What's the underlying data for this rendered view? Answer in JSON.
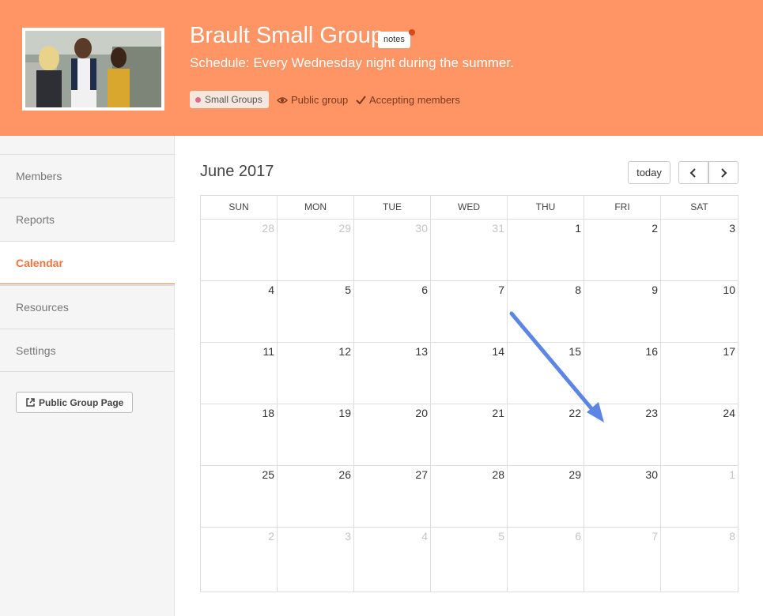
{
  "header": {
    "title": "Brault Small Group",
    "notes_badge": "notes",
    "schedule": "Schedule: Every Wednesday night during the summer.",
    "tag": "Small Groups",
    "visibility": "Public group",
    "membership": "Accepting members",
    "accent_color": "#ff9465"
  },
  "sidebar": {
    "items": [
      {
        "label": "Members"
      },
      {
        "label": "Reports"
      },
      {
        "label": "Calendar",
        "active": true
      },
      {
        "label": "Resources"
      },
      {
        "label": "Settings"
      }
    ],
    "public_page_button": "Public Group Page"
  },
  "calendar": {
    "month_title": "June 2017",
    "today_button": "today",
    "weekdays": [
      "SUN",
      "MON",
      "TUE",
      "WED",
      "THU",
      "FRI",
      "SAT"
    ],
    "weeks": [
      [
        {
          "d": "28",
          "o": true
        },
        {
          "d": "29",
          "o": true
        },
        {
          "d": "30",
          "o": true
        },
        {
          "d": "31",
          "o": true
        },
        {
          "d": "1"
        },
        {
          "d": "2"
        },
        {
          "d": "3"
        }
      ],
      [
        {
          "d": "4"
        },
        {
          "d": "5"
        },
        {
          "d": "6"
        },
        {
          "d": "7"
        },
        {
          "d": "8"
        },
        {
          "d": "9"
        },
        {
          "d": "10"
        }
      ],
      [
        {
          "d": "11"
        },
        {
          "d": "12"
        },
        {
          "d": "13"
        },
        {
          "d": "14"
        },
        {
          "d": "15"
        },
        {
          "d": "16"
        },
        {
          "d": "17"
        }
      ],
      [
        {
          "d": "18"
        },
        {
          "d": "19"
        },
        {
          "d": "20"
        },
        {
          "d": "21"
        },
        {
          "d": "22"
        },
        {
          "d": "23"
        },
        {
          "d": "24"
        }
      ],
      [
        {
          "d": "25"
        },
        {
          "d": "26"
        },
        {
          "d": "27"
        },
        {
          "d": "28"
        },
        {
          "d": "29"
        },
        {
          "d": "30"
        },
        {
          "d": "1",
          "o": true
        }
      ],
      [
        {
          "d": "2",
          "o": true
        },
        {
          "d": "3",
          "o": true
        },
        {
          "d": "4",
          "o": true
        },
        {
          "d": "5",
          "o": true
        },
        {
          "d": "6",
          "o": true
        },
        {
          "d": "7",
          "o": true
        },
        {
          "d": "8",
          "o": true
        }
      ]
    ]
  },
  "annotation": {
    "arrow_color": "#5b86e5"
  }
}
